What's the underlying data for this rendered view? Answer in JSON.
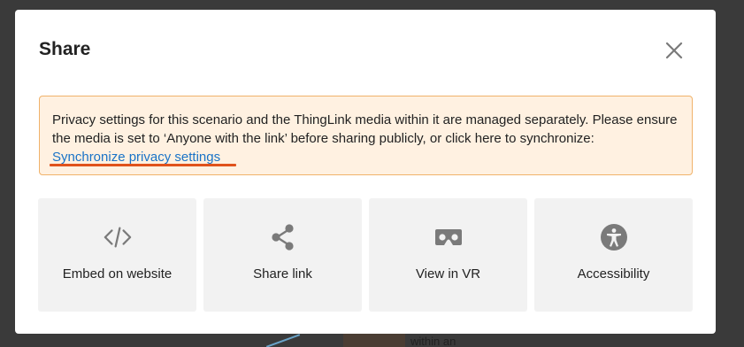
{
  "dialog": {
    "title": "Share",
    "close_icon": "close-icon"
  },
  "notice": {
    "message": "Privacy settings for this scenario and the ThingLink media within it are managed separately. Please ensure the media is set to ‘Anyone with the link’ before sharing publicly, or click here to synchronize:",
    "link_label": "Synchronize privacy settings",
    "border_color": "#f0b26a",
    "background_color": "#fff1e1",
    "link_color": "#1a73c7",
    "highlight_color": "#e0521c"
  },
  "options": [
    {
      "label": "Embed on website",
      "icon": "code-icon"
    },
    {
      "label": "Share link",
      "icon": "share-icon"
    },
    {
      "label": "View in VR",
      "icon": "vr-headset-icon"
    },
    {
      "label": "Accessibility",
      "icon": "accessibility-icon"
    }
  ],
  "background": {
    "peek_text": "within an"
  }
}
